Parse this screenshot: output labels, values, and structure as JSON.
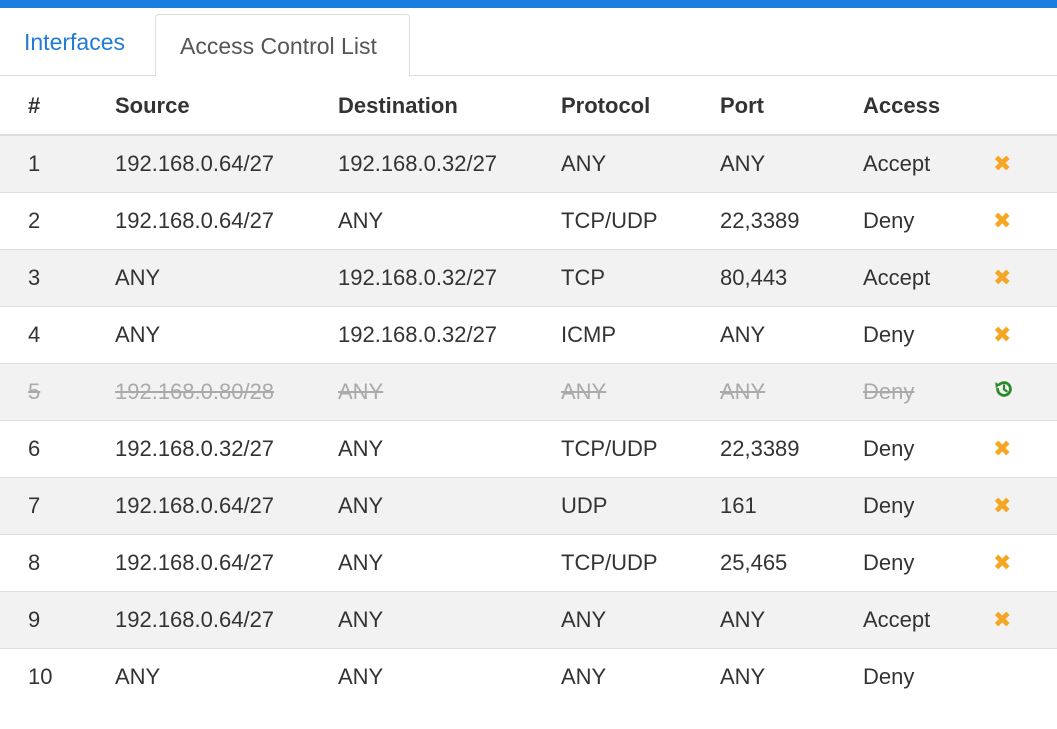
{
  "tabs": [
    {
      "label": "Interfaces",
      "active": false
    },
    {
      "label": "Access Control List",
      "active": true
    }
  ],
  "table": {
    "headers": {
      "num": "#",
      "source": "Source",
      "destination": "Destination",
      "protocol": "Protocol",
      "port": "Port",
      "access": "Access"
    },
    "rows": [
      {
        "num": "1",
        "source": "192.168.0.64/27",
        "destination": "192.168.0.32/27",
        "protocol": "ANY",
        "port": "ANY",
        "access": "Accept",
        "action_icon": "remove-icon"
      },
      {
        "num": "2",
        "source": "192.168.0.64/27",
        "destination": "ANY",
        "protocol": "TCP/UDP",
        "port": "22,3389",
        "access": "Deny",
        "action_icon": "remove-icon"
      },
      {
        "num": "3",
        "source": "ANY",
        "destination": "192.168.0.32/27",
        "protocol": "TCP",
        "port": "80,443",
        "access": "Accept",
        "action_icon": "remove-icon"
      },
      {
        "num": "4",
        "source": "ANY",
        "destination": "192.168.0.32/27",
        "protocol": "ICMP",
        "port": "ANY",
        "access": "Deny",
        "action_icon": "remove-icon"
      },
      {
        "num": "5",
        "source": "192.168.0.80/28",
        "destination": "ANY",
        "protocol": "ANY",
        "port": "ANY",
        "access": "Deny",
        "action_icon": "restore-icon",
        "disabled": true
      },
      {
        "num": "6",
        "source": "192.168.0.32/27",
        "destination": "ANY",
        "protocol": "TCP/UDP",
        "port": "22,3389",
        "access": "Deny",
        "action_icon": "remove-icon"
      },
      {
        "num": "7",
        "source": "192.168.0.64/27",
        "destination": "ANY",
        "protocol": "UDP",
        "port": "161",
        "access": "Deny",
        "action_icon": "remove-icon"
      },
      {
        "num": "8",
        "source": "192.168.0.64/27",
        "destination": "ANY",
        "protocol": "TCP/UDP",
        "port": "25,465",
        "access": "Deny",
        "action_icon": "remove-icon"
      },
      {
        "num": "9",
        "source": "192.168.0.64/27",
        "destination": "ANY",
        "protocol": "ANY",
        "port": "ANY",
        "access": "Accept",
        "action_icon": "remove-icon"
      },
      {
        "num": "10",
        "source": "ANY",
        "destination": "ANY",
        "protocol": "ANY",
        "port": "ANY",
        "access": "Deny",
        "action_icon": null
      }
    ]
  },
  "colors": {
    "accent": "#1a7de0",
    "link": "#1f7bd6",
    "remove_icon": "#f5a623",
    "restore_icon": "#2a8a2a",
    "stripe": "#f2f2f2",
    "disabled_text": "#aaaaaa"
  }
}
